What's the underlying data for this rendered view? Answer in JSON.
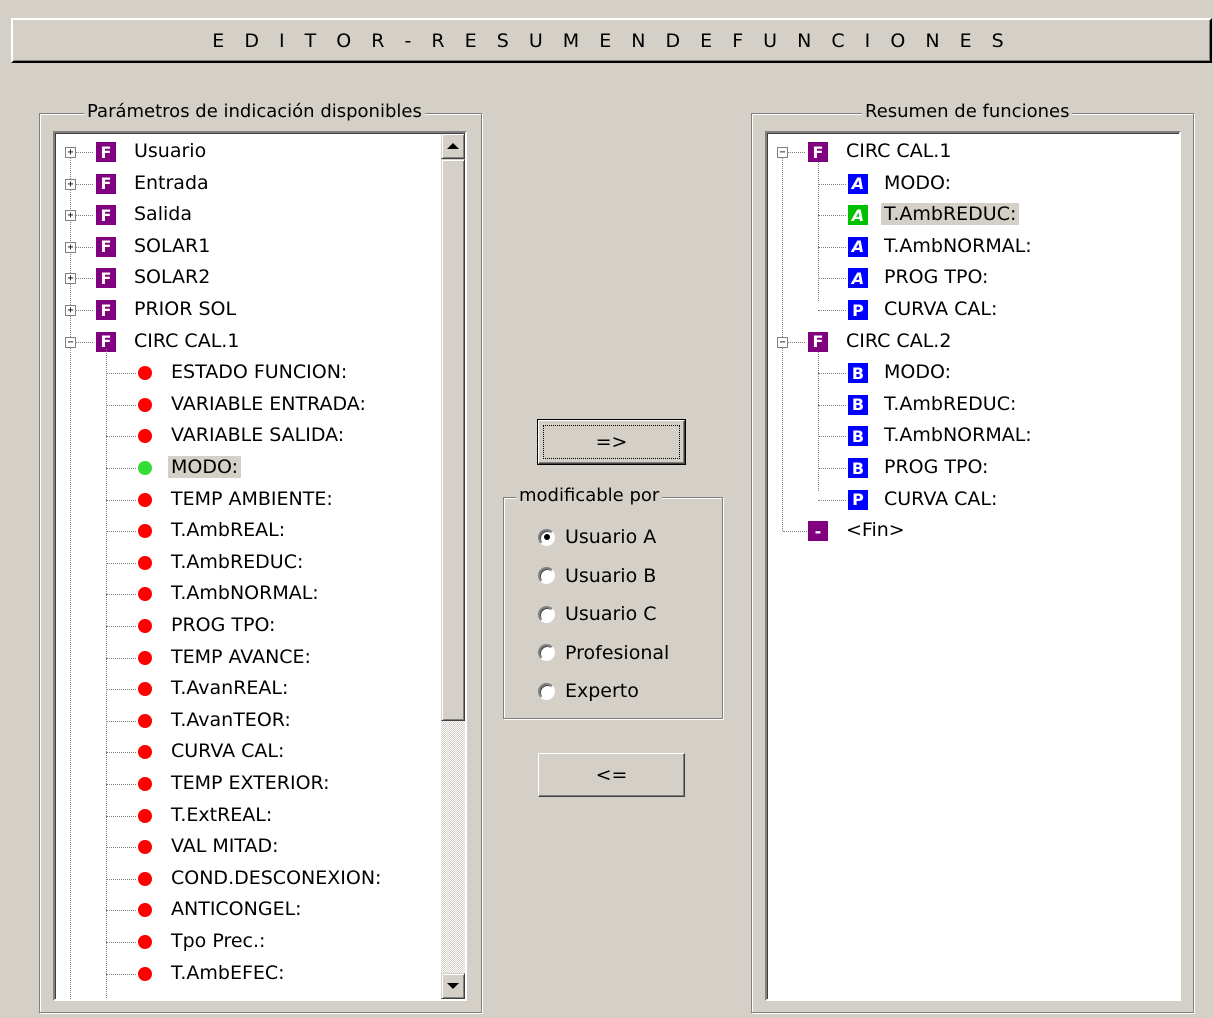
{
  "window": {
    "title": "E D I T O R  -  R E S U M E N  D E  F U N C I O N E S"
  },
  "colors": {
    "f_icon": "#800080",
    "a_icon": "#0000ff",
    "a_icon_selected": "#00c000",
    "b_icon": "#0000ff",
    "p_icon": "#0000ff",
    "dot_red": "#ff0000",
    "dot_green": "#33dd33"
  },
  "left_panel": {
    "legend": "Parámetros de indicación disponibles",
    "items": [
      {
        "label": "Usuario",
        "icon": "F",
        "expander": "+"
      },
      {
        "label": "Entrada",
        "icon": "F",
        "expander": "+"
      },
      {
        "label": "Salida",
        "icon": "F",
        "expander": "+"
      },
      {
        "label": "SOLAR1",
        "icon": "F",
        "expander": "+"
      },
      {
        "label": "SOLAR2",
        "icon": "F",
        "expander": "+"
      },
      {
        "label": "PRIOR SOL",
        "icon": "F",
        "expander": "+"
      },
      {
        "label": "CIRC CAL.1",
        "icon": "F",
        "expander": "-"
      },
      {
        "label": "ESTADO FUNCION:",
        "icon": "red-dot"
      },
      {
        "label": "VARIABLE ENTRADA:",
        "icon": "red-dot"
      },
      {
        "label": "VARIABLE SALIDA:",
        "icon": "red-dot"
      },
      {
        "label": "MODO:",
        "icon": "green-dot",
        "selected": true
      },
      {
        "label": "TEMP AMBIENTE:",
        "icon": "red-dot"
      },
      {
        "label": "T.AmbREAL:",
        "icon": "red-dot"
      },
      {
        "label": "T.AmbREDUC:",
        "icon": "red-dot"
      },
      {
        "label": "T.AmbNORMAL:",
        "icon": "red-dot"
      },
      {
        "label": "PROG TPO:",
        "icon": "red-dot"
      },
      {
        "label": "TEMP AVANCE:",
        "icon": "red-dot"
      },
      {
        "label": "T.AvanREAL:",
        "icon": "red-dot"
      },
      {
        "label": "T.AvanTEOR:",
        "icon": "red-dot"
      },
      {
        "label": "CURVA CAL:",
        "icon": "red-dot"
      },
      {
        "label": "TEMP EXTERIOR:",
        "icon": "red-dot"
      },
      {
        "label": "T.ExtREAL:",
        "icon": "red-dot"
      },
      {
        "label": "VAL MITAD:",
        "icon": "red-dot"
      },
      {
        "label": "COND.DESCONEXION:",
        "icon": "red-dot"
      },
      {
        "label": "ANTICONGEL:",
        "icon": "red-dot"
      },
      {
        "label": "Tpo Prec.:",
        "icon": "red-dot"
      },
      {
        "label": "T.AmbEFEC:",
        "icon": "red-dot"
      }
    ]
  },
  "middle": {
    "add_button": "=>",
    "remove_button": "<=",
    "group_legend": "modificable por",
    "radios": [
      {
        "label": "Usuario A",
        "checked": true
      },
      {
        "label": "Usuario B",
        "checked": false
      },
      {
        "label": "Usuario C",
        "checked": false
      },
      {
        "label": "Profesional",
        "checked": false
      },
      {
        "label": "Experto",
        "checked": false
      }
    ]
  },
  "right_panel": {
    "legend": "Resumen de funciones",
    "items": [
      {
        "label": "CIRC CAL.1",
        "icon": "F",
        "expander": "-",
        "level": 0
      },
      {
        "label": "MODO:",
        "icon": "A",
        "level": 1
      },
      {
        "label": "T.AmbREDUC:",
        "icon": "A",
        "level": 1,
        "selected": true
      },
      {
        "label": "T.AmbNORMAL:",
        "icon": "A",
        "level": 1
      },
      {
        "label": "PROG TPO:",
        "icon": "A",
        "level": 1
      },
      {
        "label": "CURVA CAL:",
        "icon": "P",
        "level": 1
      },
      {
        "label": "CIRC CAL.2",
        "icon": "F",
        "expander": "-",
        "level": 0
      },
      {
        "label": "MODO:",
        "icon": "B",
        "level": 1
      },
      {
        "label": "T.AmbREDUC:",
        "icon": "B",
        "level": 1
      },
      {
        "label": "T.AmbNORMAL:",
        "icon": "B",
        "level": 1
      },
      {
        "label": "PROG TPO:",
        "icon": "B",
        "level": 1
      },
      {
        "label": "CURVA CAL:",
        "icon": "P",
        "level": 1
      },
      {
        "label": "<Fin>",
        "icon": "-",
        "level": 0
      }
    ]
  }
}
